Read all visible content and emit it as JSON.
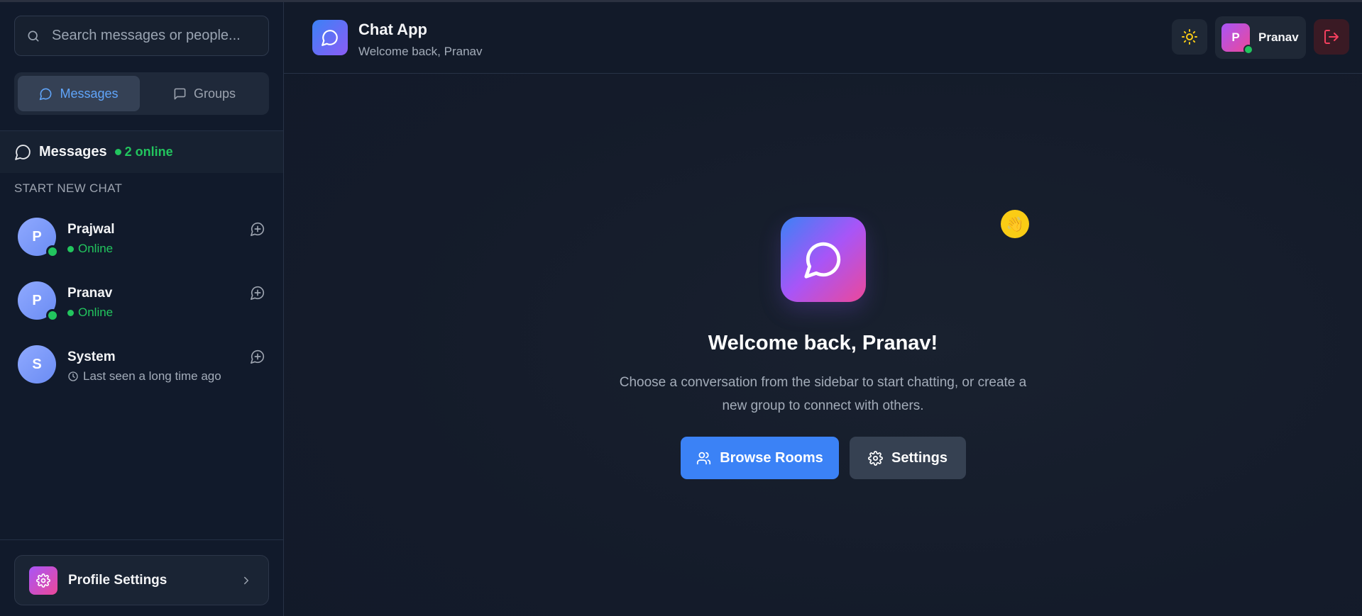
{
  "sidebar": {
    "search": {
      "placeholder": "Search messages or people..."
    },
    "tabs": [
      {
        "label": "Messages",
        "active": true
      },
      {
        "label": "Groups",
        "active": false
      }
    ],
    "section": {
      "title": "Messages",
      "online_count": "2 online"
    },
    "start_new_chat": "START NEW CHAT",
    "contacts": [
      {
        "initial": "P",
        "name": "Prajwal",
        "status": "Online",
        "online": true
      },
      {
        "initial": "P",
        "name": "Pranav",
        "status": "Online",
        "online": true
      },
      {
        "initial": "S",
        "name": "System",
        "status": "Last seen a long time ago",
        "online": false
      }
    ],
    "profile_settings": {
      "label": "Profile Settings"
    }
  },
  "header": {
    "title": "Chat App",
    "subtitle": "Welcome back, Pranav",
    "user": {
      "initial": "P",
      "name": "Pranav"
    }
  },
  "main": {
    "welcome_title": "Welcome back, Pranav!",
    "welcome_text": "Choose a conversation from the sidebar to start chatting, or create a new group to connect with others.",
    "browse_label": "Browse Rooms",
    "settings_label": "Settings"
  },
  "colors": {
    "accent": "#3b82f6",
    "online": "#22c55e",
    "gradient_start": "#3b82f6",
    "gradient_mid": "#a855f7",
    "gradient_end": "#ec4899"
  }
}
